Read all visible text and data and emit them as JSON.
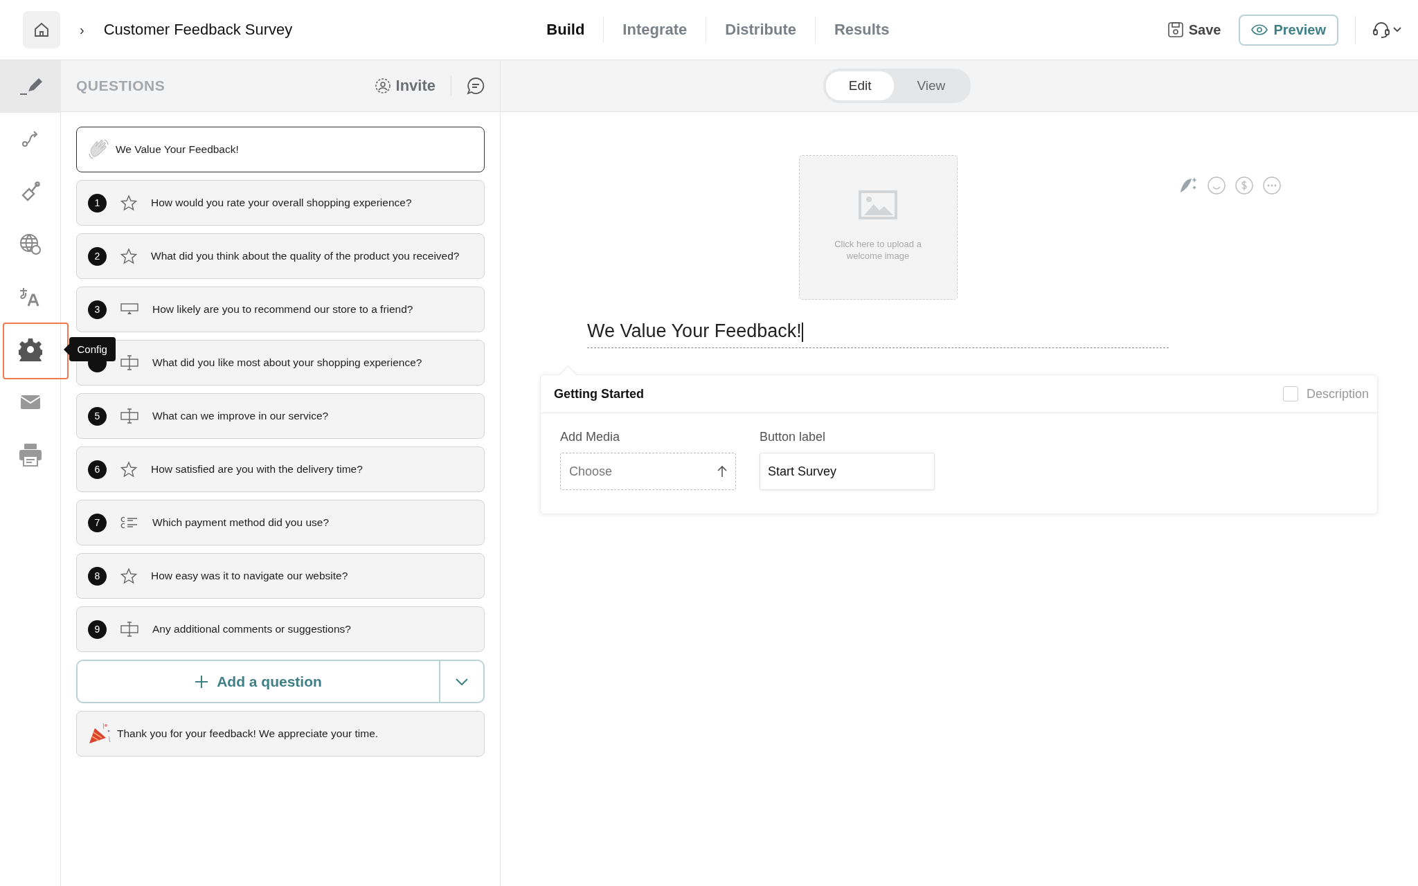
{
  "header": {
    "breadcrumb_separator": "›",
    "title": "Customer Feedback Survey"
  },
  "tabs": [
    {
      "label": "Build",
      "selected": true
    },
    {
      "label": "Integrate",
      "selected": false
    },
    {
      "label": "Distribute",
      "selected": false
    },
    {
      "label": "Results",
      "selected": false
    }
  ],
  "actions": {
    "save": "Save",
    "preview": "Preview"
  },
  "rail": [
    {
      "kind": "pen",
      "selected": true,
      "highlighted": false
    },
    {
      "kind": "flow",
      "selected": false,
      "highlighted": false
    },
    {
      "kind": "brush",
      "selected": false,
      "highlighted": false
    },
    {
      "kind": "globe",
      "selected": false,
      "highlighted": false
    },
    {
      "kind": "translate",
      "selected": false,
      "highlighted": false
    },
    {
      "kind": "gear",
      "selected": false,
      "highlighted": true,
      "tooltip": "Config"
    },
    {
      "kind": "mail",
      "selected": false,
      "highlighted": false
    },
    {
      "kind": "printer",
      "selected": false,
      "highlighted": false
    }
  ],
  "questions_panel": {
    "heading": "QUESTIONS",
    "invite": "Invite",
    "welcome": {
      "text": "We Value Your Feedback!",
      "selected": true
    },
    "questions": [
      {
        "number": "1",
        "kind": "rating",
        "text": "How would you rate your overall shopping experience?"
      },
      {
        "number": "2",
        "kind": "rating",
        "text": "What did you think about the quality of the product you received?"
      },
      {
        "number": "3",
        "kind": "nps",
        "text": "How likely are you to recommend our store to a friend?"
      },
      {
        "kind": "text",
        "text": "What did you like most about your shopping experience?"
      },
      {
        "number": "5",
        "kind": "text",
        "text": "What can we improve in our service?"
      },
      {
        "number": "6",
        "kind": "rating",
        "text": "How satisfied are you with the delivery time?"
      },
      {
        "number": "7",
        "kind": "choice",
        "text": "Which payment method did you use?"
      },
      {
        "number": "8",
        "kind": "rating",
        "text": "How easy was it to navigate our website?"
      },
      {
        "number": "9",
        "kind": "text",
        "text": "Any additional comments or suggestions?"
      }
    ],
    "add_question": "Add a question",
    "thank_you": "Thank you for your feedback! We appreciate your time."
  },
  "view_toggle": [
    {
      "label": "Edit",
      "selected": true
    },
    {
      "label": "View",
      "selected": false
    }
  ],
  "editor": {
    "upload_hint": "Click here to upload a welcome image",
    "title": "We Value Your Feedback!",
    "settings": {
      "heading": "Getting Started",
      "description": {
        "label": "Description",
        "checked": false
      },
      "media": {
        "label": "Add Media",
        "placeholder": "Choose"
      },
      "button_label": {
        "label": "Button label",
        "value": "Start Survey"
      }
    }
  }
}
